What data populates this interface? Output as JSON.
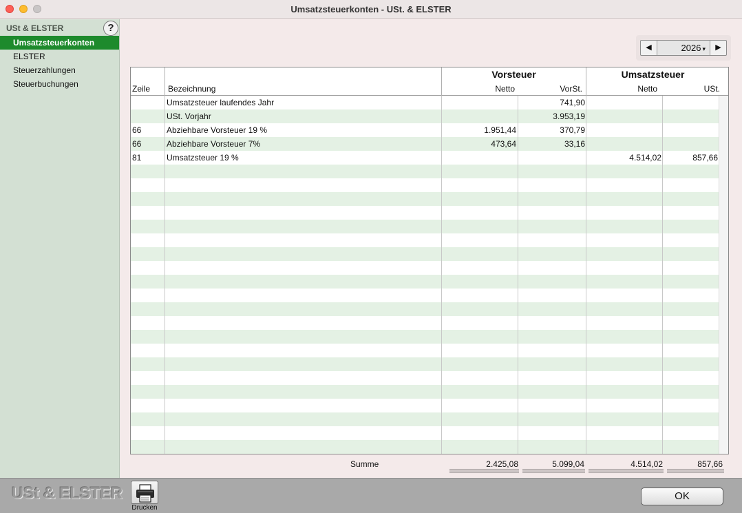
{
  "window": {
    "title": "Umsatzsteuerkonten - USt. & ELSTER"
  },
  "sidebar": {
    "section_title": "USt & ELSTER",
    "help_label": "?",
    "items": [
      {
        "label": "Umsatzsteuerkonten",
        "selected": true
      },
      {
        "label": "ELSTER",
        "selected": false
      },
      {
        "label": "Steuerzahlungen",
        "selected": false
      },
      {
        "label": "Steuerbuchungen",
        "selected": false
      }
    ]
  },
  "year_selector": {
    "prev": "◀",
    "value": "2026",
    "next": "▶"
  },
  "table": {
    "headers": {
      "zeile": "Zeile",
      "bezeichnung": "Bezeichnung",
      "vorsteuer_group": "Vorsteuer",
      "umsatzsteuer_group": "Umsatzsteuer",
      "vor_netto": "Netto",
      "vor_vorst": "VorSt.",
      "ums_netto": "Netto",
      "ums_ust": "USt."
    },
    "rows": [
      {
        "zeile": "",
        "bezeichnung": "Umsatzsteuer laufendes Jahr",
        "vor_netto": "",
        "vor_vorst": "741,90",
        "ums_netto": "",
        "ums_ust": ""
      },
      {
        "zeile": "",
        "bezeichnung": "USt. Vorjahr",
        "vor_netto": "",
        "vor_vorst": "3.953,19",
        "ums_netto": "",
        "ums_ust": ""
      },
      {
        "zeile": "66",
        "bezeichnung": "Abziehbare Vorsteuer 19 %",
        "vor_netto": "1.951,44",
        "vor_vorst": "370,79",
        "ums_netto": "",
        "ums_ust": ""
      },
      {
        "zeile": "66",
        "bezeichnung": "Abziehbare Vorsteuer 7%",
        "vor_netto": "473,64",
        "vor_vorst": "33,16",
        "ums_netto": "",
        "ums_ust": ""
      },
      {
        "zeile": "81",
        "bezeichnung": "Umsatzsteuer 19 %",
        "vor_netto": "",
        "vor_vorst": "",
        "ums_netto": "4.514,02",
        "ums_ust": "857,66"
      }
    ],
    "summe": {
      "label": "Summe",
      "vor_netto": "2.425,08",
      "vor_vorst": "5.099,04",
      "ums_netto": "4.514,02",
      "ums_ust": "857,66"
    }
  },
  "bottom_bar": {
    "app_logo": "USt & ELSTER",
    "print_label": "Drucken",
    "ok_label": "OK"
  },
  "colors": {
    "selection": "#1d8a2c",
    "sidebar_bg": "#d3e0d3",
    "row_alt": "#e4f1e4"
  }
}
